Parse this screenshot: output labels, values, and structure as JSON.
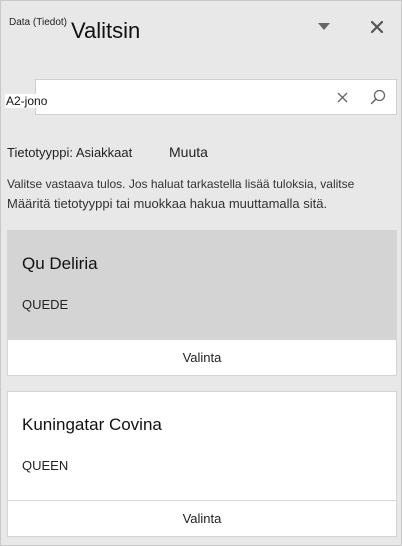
{
  "header": {
    "tiny_label": "Data (Tiedot)",
    "title": "Valitsin"
  },
  "icons": {
    "dropdown": "chevron-down-icon",
    "close": "close-icon",
    "clear": "clear-icon",
    "search": "search-icon"
  },
  "search": {
    "value": "A2-jono"
  },
  "type_row": {
    "label": "Tietotyyppi: Asiakkaat",
    "change_link": "Muuta"
  },
  "help": {
    "line1": "Valitse vastaava tulos. Jos haluat tarkastella lisää tuloksia, valitse",
    "line2": "Määritä tietotyyppi tai muokkaa hakua muuttamalla sitä."
  },
  "results": [
    {
      "name": "Qu Deliria",
      "code": "QUEDE",
      "action": "Valinta",
      "selected": true
    },
    {
      "name": "Kuningatar Covina",
      "code": "QUEEN",
      "action": "Valinta",
      "selected": false
    }
  ],
  "colors": {
    "pane_bg": "#e8e8e8",
    "selected_card_bg": "#d4d4d4",
    "icon_gray": "#666666"
  }
}
